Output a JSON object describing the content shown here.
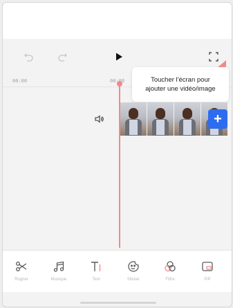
{
  "editor": {
    "time_start": "00:00",
    "time_mid": "00:00",
    "tooltip_line1": "Toucher l'écran pour",
    "tooltip_line2": "ajouter une vidéo/image",
    "add_label": "+"
  },
  "toolbar": {
    "items": [
      {
        "label": "Rogner",
        "icon": "scissors-icon"
      },
      {
        "label": "Musique",
        "icon": "music-note-icon"
      },
      {
        "label": "Text",
        "icon": "text-icon"
      },
      {
        "label": "Sticker",
        "icon": "sticker-icon"
      },
      {
        "label": "Filtre",
        "icon": "filter-icon"
      },
      {
        "label": "PiP",
        "icon": "pip-icon"
      }
    ]
  },
  "colors": {
    "accent": "#2d6cf0",
    "playhead": "#f08a8a",
    "icon": "#5a5a5e"
  }
}
